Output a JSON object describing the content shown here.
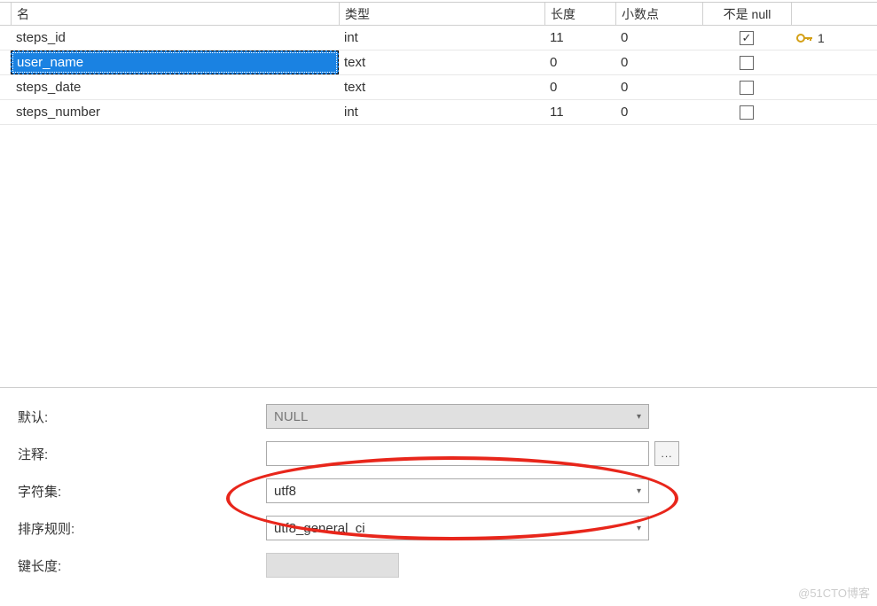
{
  "headers": {
    "name": "名",
    "type": "类型",
    "length": "长度",
    "decimal": "小数点",
    "notnull": "不是 null"
  },
  "rows": [
    {
      "name": "steps_id",
      "type": "int",
      "length": "11",
      "decimal": "0",
      "notnull": true,
      "key": "1",
      "selected": false
    },
    {
      "name": "user_name",
      "type": "text",
      "length": "0",
      "decimal": "0",
      "notnull": false,
      "key": "",
      "selected": true
    },
    {
      "name": "steps_date",
      "type": "text",
      "length": "0",
      "decimal": "0",
      "notnull": false,
      "key": "",
      "selected": false
    },
    {
      "name": "steps_number",
      "type": "int",
      "length": "11",
      "decimal": "0",
      "notnull": false,
      "key": "",
      "selected": false
    }
  ],
  "props": {
    "default_label": "默认:",
    "default_value": "NULL",
    "comment_label": "注释:",
    "comment_value": "",
    "charset_label": "字符集:",
    "charset_value": "utf8",
    "collation_label": "排序规则:",
    "collation_value": "utf8_general_ci",
    "keylength_label": "键长度:",
    "keylength_value": ""
  },
  "ellipsis": "...",
  "watermark": "@51CTO博客"
}
